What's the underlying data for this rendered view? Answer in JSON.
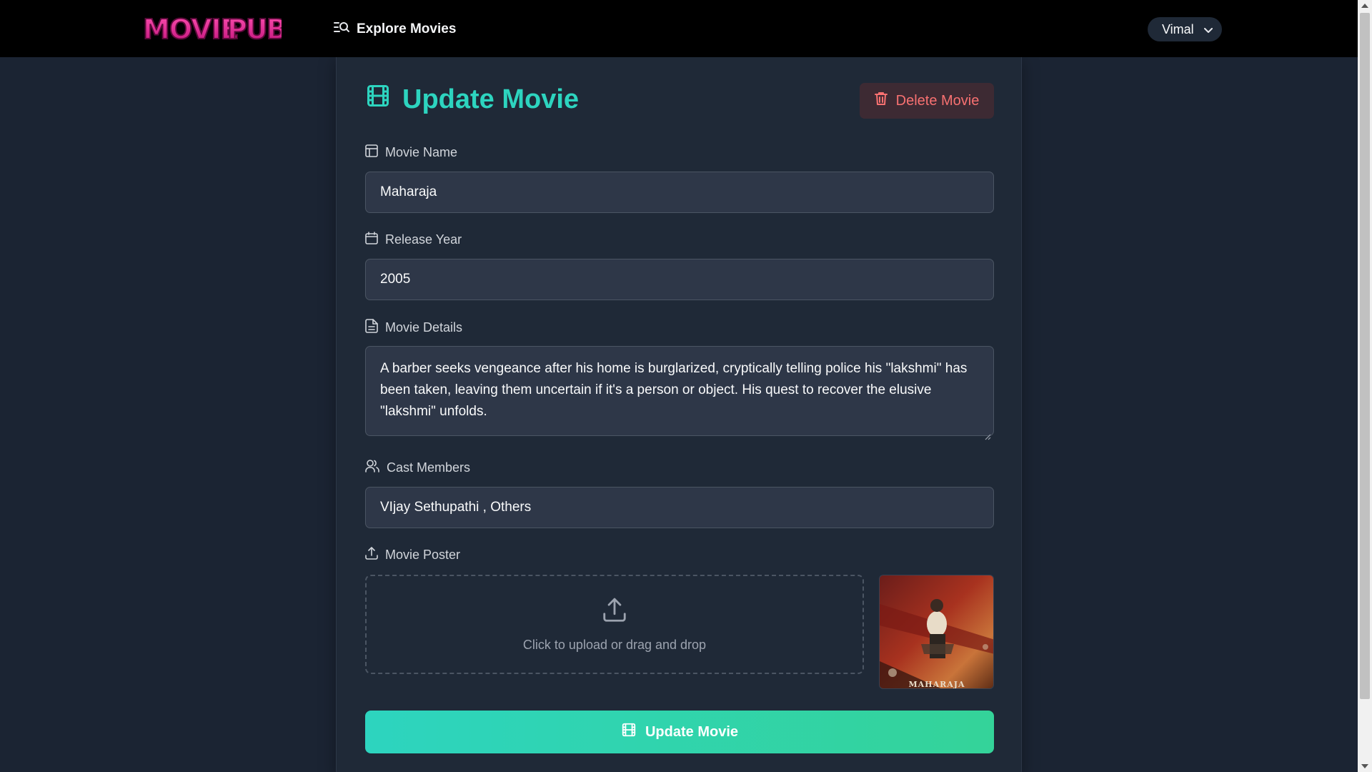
{
  "app": {
    "logo_text": "MOVIE PUB",
    "nav_explore": "Explore Movies",
    "user_name": "Vimal"
  },
  "form": {
    "title": "Update Movie",
    "delete_label": "Delete Movie",
    "movie_name": {
      "label": "Movie Name",
      "value": "Maharaja"
    },
    "release_year": {
      "label": "Release Year",
      "value": "2005"
    },
    "movie_details": {
      "label": "Movie Details",
      "value": "A barber seeks vengeance after his home is burglarized, cryptically telling police his \"lakshmi\" has been taken, leaving them uncertain if it's a person or object. His quest to recover the elusive \"lakshmi\" unfolds."
    },
    "cast_members": {
      "label": "Cast Members",
      "value": "VIjay Sethupathi , Others"
    },
    "movie_poster": {
      "label": "Movie Poster",
      "upload_hint": "Click to upload or drag and drop",
      "poster_caption": "MAHARAJA"
    },
    "submit_label": "Update Movie"
  },
  "colors": {
    "accent": "#2dd4bf",
    "accent_end": "#34d399",
    "danger": "#f87171",
    "background": "#1b2433",
    "card": "#1f2937",
    "input": "#2e3748"
  },
  "icons": {
    "explore": "search-list-icon",
    "title": "film-icon",
    "delete": "trash-icon",
    "movie_name": "layout-icon",
    "release_year": "calendar-icon",
    "movie_details": "file-text-icon",
    "cast_members": "users-icon",
    "movie_poster": "upload-icon",
    "dropdown": "chevron-down-icon"
  }
}
